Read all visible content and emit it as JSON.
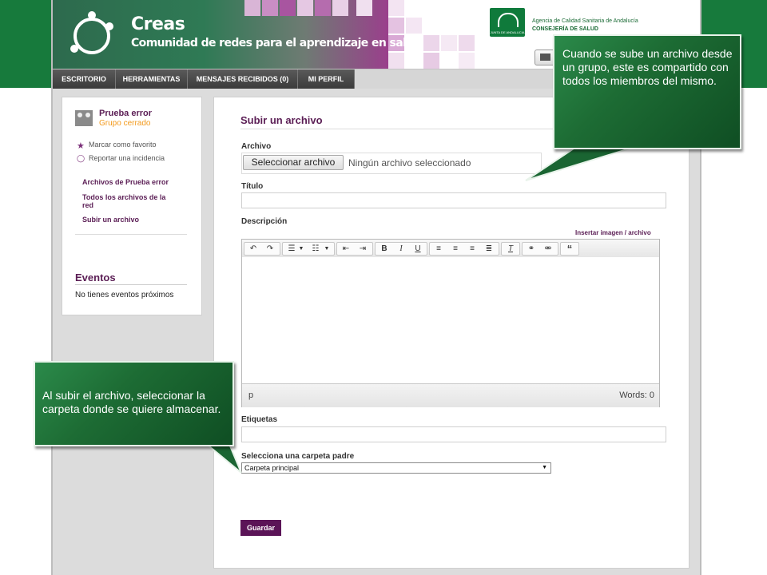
{
  "header": {
    "brand_title": "Creas",
    "brand_subtitle": "Comunidad de redes para el aprendizaje en salud",
    "agency_line1": "Agencia de Calidad Sanitaria de Andalucía",
    "agency_line2": "CONSEJERÍA DE SALUD",
    "junta_logo_text": "JUNTA DE ANDALUCIA",
    "mail_icon": "envelope-icon"
  },
  "nav": {
    "items": [
      {
        "label": "ESCRITORIO"
      },
      {
        "label": "HERRAMIENTAS"
      },
      {
        "label": "MENSAJES RECIBIDOS (0)"
      },
      {
        "label": "MI PERFIL"
      }
    ]
  },
  "sidebar": {
    "group_name": "Prueba error",
    "group_type": "Grupo cerrado",
    "actions": [
      {
        "label": "Marcar como favorito",
        "icon": "star-icon"
      },
      {
        "label": "Reportar una incidencia",
        "icon": "speech-bubble-icon"
      }
    ],
    "links": [
      {
        "label": "Archivos de Prueba error"
      },
      {
        "label": "Todos los archivos de la red"
      },
      {
        "label": "Subir un archivo"
      }
    ],
    "events_title": "Eventos",
    "events_empty": "No tienes eventos próximos"
  },
  "form": {
    "title": "Subir un archivo",
    "file_label": "Archivo",
    "file_button": "Seleccionar archivo",
    "file_status": "Ningún archivo seleccionado",
    "title_label": "Título",
    "title_value": "",
    "description_label": "Descripción",
    "insert_link": "Insertar imagen / archivo",
    "editor_path": "p",
    "editor_words": "Words: 0",
    "tags_label": "Etiquetas",
    "tags_value": "",
    "folder_label": "Selecciona una carpeta padre",
    "folder_selected": "Carpeta principal",
    "save_button": "Guardar"
  },
  "callouts": {
    "top_right": "Cuando se sube un archivo desde un grupo, este es compartido con todos los miembros del mismo.",
    "left": "Al subir el archivo, seleccionar la carpeta donde se quiere almacenar."
  },
  "colors": {
    "accent_purple": "#5b1e55",
    "group_orange": "#f39a1c",
    "side_green": "#177a3c",
    "save_purple": "#5b1457"
  }
}
